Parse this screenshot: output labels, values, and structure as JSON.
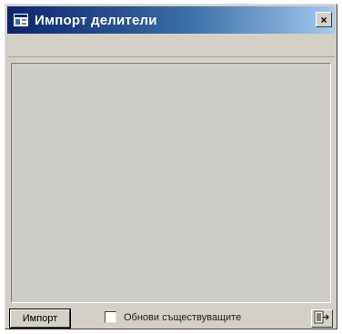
{
  "window": {
    "title": "Импорт делители",
    "close_label": "×"
  },
  "toolbar": {
    "import_label": "Импорт",
    "checkbox_label": "Обнови съществуващите",
    "checkbox_checked": false
  },
  "icons": {
    "app": "app-window-icon",
    "close": "close-icon",
    "exit": "exit-door-icon"
  },
  "colors": {
    "titlebar_start": "#0a246a",
    "titlebar_end": "#a6caf0",
    "face": "#d4d0c8"
  }
}
